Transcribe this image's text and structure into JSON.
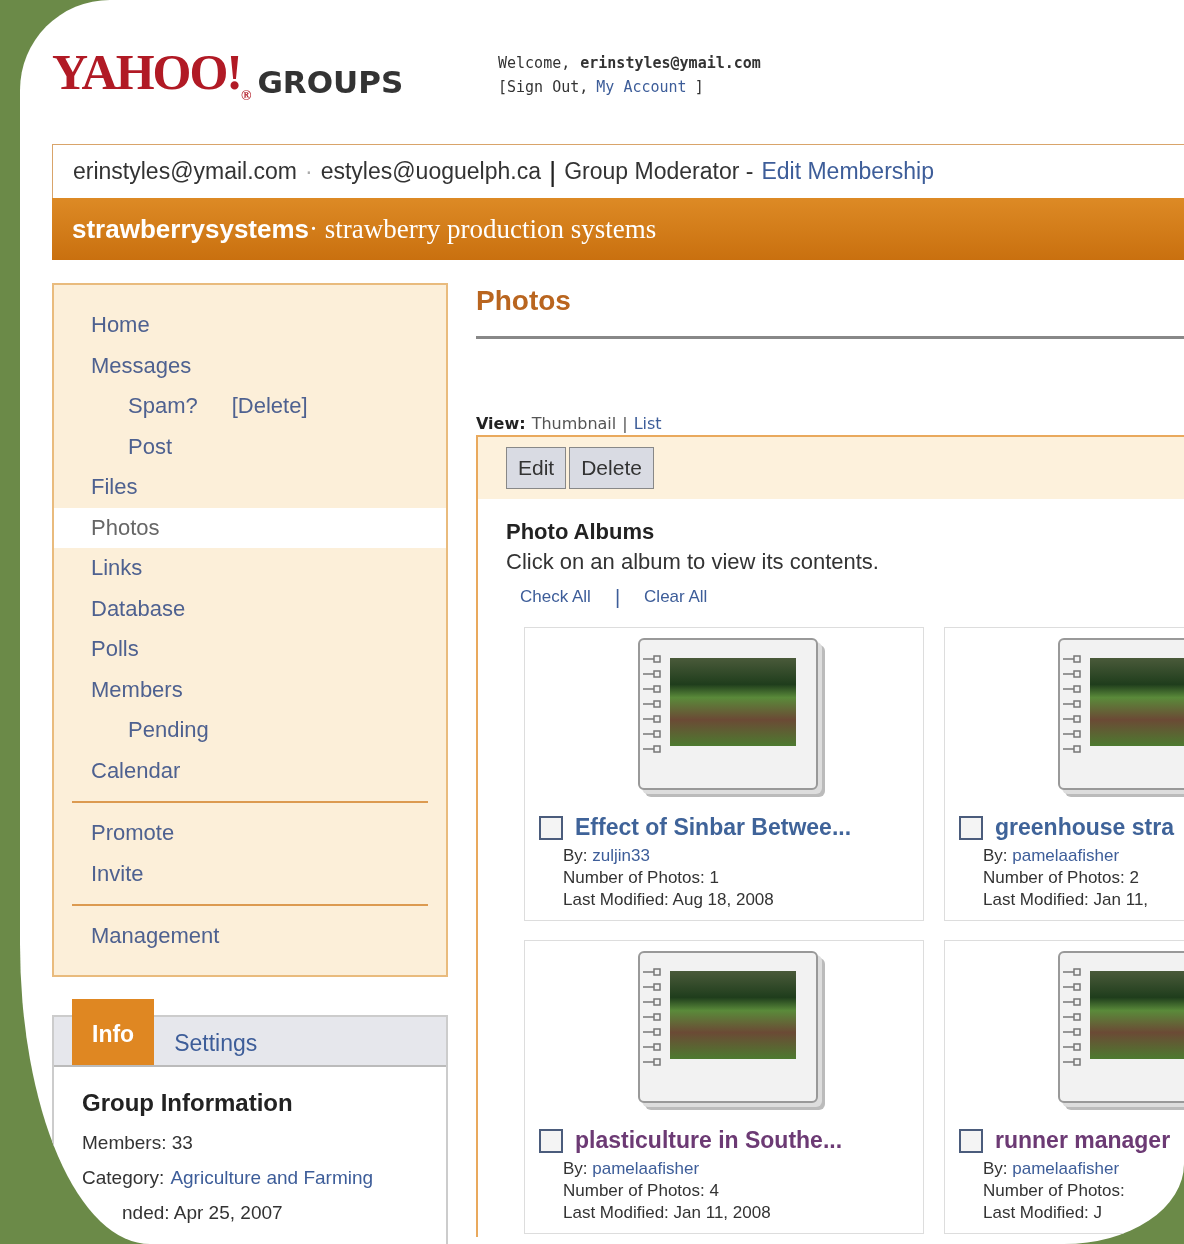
{
  "header": {
    "logo": {
      "brand": "YAHOO!",
      "registered": "®",
      "product": "GROUPS"
    },
    "welcome": {
      "label": "Welcome,",
      "user": "erinstyles@ymail.com",
      "open": "[Sign Out,",
      "link": "My Account",
      "close": "]"
    }
  },
  "member_bar": {
    "primary_email": "erinstyles@ymail.com",
    "separator": "·",
    "secondary_email": "estyles@uoguelph.ca",
    "divider": "|",
    "role": "Group Moderator -",
    "link": "Edit Membership"
  },
  "group_bar": {
    "name": "strawberrysystems",
    "description": "· strawberry production systems"
  },
  "sidebar": {
    "sections": [
      [
        {
          "label": "Home",
          "selected": false
        },
        {
          "label": "Messages",
          "selected": false,
          "children": [
            {
              "label": "Spam?",
              "action": "[Delete]",
              "selected": false
            },
            {
              "label": "Post",
              "selected": false
            }
          ]
        },
        {
          "label": "Files",
          "selected": false
        },
        {
          "label": "Photos",
          "selected": true
        },
        {
          "label": "Links",
          "selected": false
        },
        {
          "label": "Database",
          "selected": false
        },
        {
          "label": "Polls",
          "selected": false
        },
        {
          "label": "Members",
          "selected": false,
          "children": [
            {
              "label": "Pending",
              "selected": false
            }
          ]
        },
        {
          "label": "Calendar",
          "selected": false
        }
      ],
      [
        {
          "label": "Promote",
          "selected": false
        },
        {
          "label": "Invite",
          "selected": false
        }
      ],
      [
        {
          "label": "Management",
          "selected": false
        }
      ]
    ]
  },
  "info_panel": {
    "tabs": [
      {
        "label": "Info",
        "selected": true
      },
      {
        "label": "Settings",
        "selected": false
      }
    ],
    "heading": "Group Information",
    "rows": [
      {
        "label": "Members: 33"
      },
      {
        "label": "Category:",
        "link": "Agriculture and Farming"
      },
      {
        "label": "nded: Apr 25, 2007"
      }
    ]
  },
  "main": {
    "title": "Photos",
    "view": {
      "label": "View:",
      "options": [
        {
          "label": "Thumbnail",
          "selected": true
        },
        {
          "label": "List",
          "selected": false
        }
      ],
      "separator": "|"
    },
    "toolbar": [
      "Edit",
      "Delete"
    ],
    "heading": "Photo Albums",
    "description": "Click on an album to view its contents.",
    "bulk": {
      "check_all": "Check All",
      "separator": "|",
      "clear_all": "Clear All"
    },
    "albums": [
      {
        "title": "Effect of Sinbar Betwee...",
        "checked": false,
        "visited": false,
        "by_label": "By:",
        "by": "zuljin33",
        "count": "Number of Photos: 1",
        "modified": "Last Modified: Aug 18, 2008"
      },
      {
        "title": "greenhouse stra",
        "checked": false,
        "visited": false,
        "by_label": "By:",
        "by": "pamelaafisher",
        "count": "Number of Photos: 2",
        "modified": "Last Modified: Jan 11,"
      },
      {
        "title": "plasticulture in Southe...",
        "checked": false,
        "visited": true,
        "by_label": "By:",
        "by": "pamelaafisher",
        "count": "Number of Photos: 4",
        "modified": "Last Modified: Jan 11, 2008"
      },
      {
        "title": "runner manager",
        "checked": false,
        "visited": true,
        "by_label": "By:",
        "by": "pamelaafisher",
        "count": "Number of Photos:",
        "modified": "Last Modified: J"
      }
    ]
  }
}
